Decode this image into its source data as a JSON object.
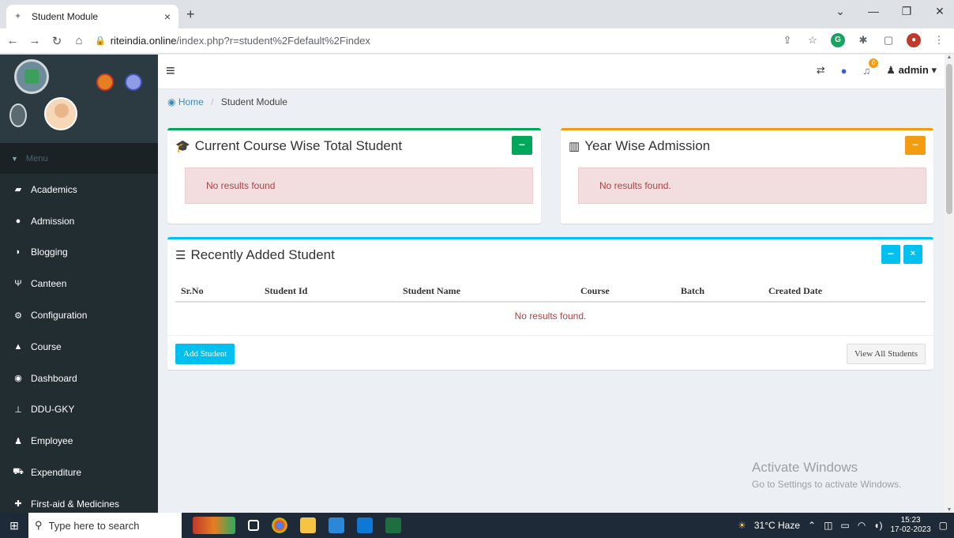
{
  "browser": {
    "tab_title": "Student Module",
    "tab_close": "×",
    "new_tab": "+",
    "url_host": "riteindia.online",
    "url_path": "/index.php?r=student%2Fdefault%2Findex",
    "window_buttons": [
      "⌄",
      "—",
      "❐",
      "✕"
    ]
  },
  "sidebar": {
    "menu_label": "Menu",
    "items": [
      {
        "label": "Academics",
        "icon": "book-icon"
      },
      {
        "label": "Admission",
        "icon": "circle-icon"
      },
      {
        "label": "Blogging",
        "icon": "rss-icon"
      },
      {
        "label": "Canteen",
        "icon": "cutlery-icon"
      },
      {
        "label": "Configuration",
        "icon": "cogs-icon"
      },
      {
        "label": "Course",
        "icon": "graduation-cap-icon"
      },
      {
        "label": "Dashboard",
        "icon": "dashboard-icon"
      },
      {
        "label": "DDU-GKY",
        "icon": "sitemap-icon"
      },
      {
        "label": "Employee",
        "icon": "user-icon"
      },
      {
        "label": "Expenditure",
        "icon": "cart-icon"
      },
      {
        "label": "First-aid & Medicines",
        "icon": "medkit-icon"
      }
    ]
  },
  "header": {
    "user": "admin",
    "notification_count": "0"
  },
  "breadcrumb": {
    "home": "Home",
    "current": "Student Module"
  },
  "course_box": {
    "title": "Current Course Wise Total Student",
    "message": "No results found",
    "color": "#00a65a"
  },
  "year_box": {
    "title": "Year Wise Admission",
    "message": "No results found.",
    "color": "#f39c12"
  },
  "recent_box": {
    "title": "Recently Added Student",
    "color": "#00c0ef",
    "columns": [
      "Sr.No",
      "Student Id",
      "Student Name",
      "Course",
      "Batch",
      "Created Date"
    ],
    "empty_message": "No results found.",
    "add_button": "Add Student",
    "view_button": "View All Students"
  },
  "watermark": {
    "line1": "Activate Windows",
    "line2": "Go to Settings to activate Windows."
  },
  "taskbar": {
    "search_placeholder": "Type here to search",
    "weather": "31°C  Haze",
    "time": "15:23",
    "date": "17-02-2023"
  }
}
